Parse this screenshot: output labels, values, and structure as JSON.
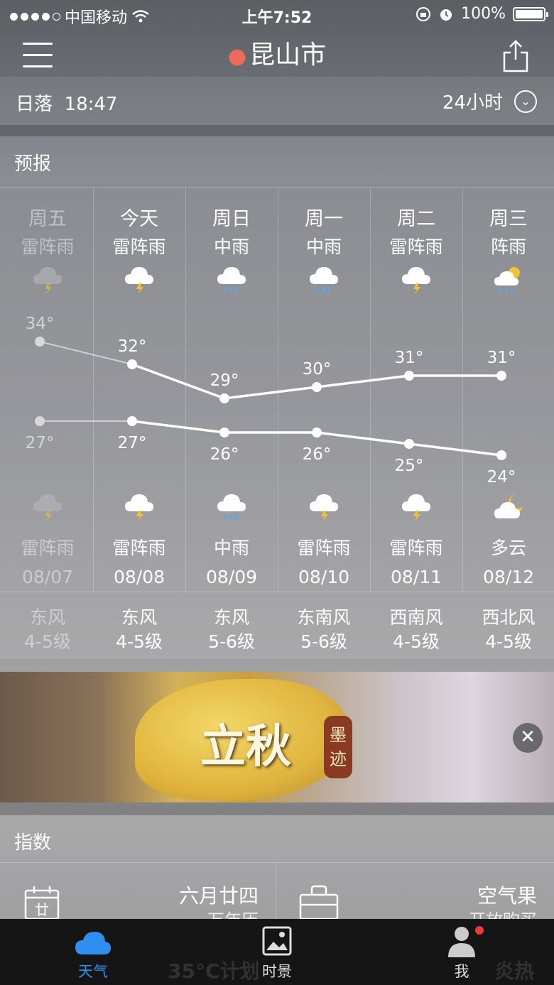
{
  "status_bar": {
    "carrier": "中国移动",
    "time": "上午7:52",
    "battery": "100%"
  },
  "header": {
    "city": "昆山市"
  },
  "sunset": {
    "label": "日落",
    "time": "18:47",
    "hours_toggle": "24小时"
  },
  "forecast": {
    "title": "预报",
    "days": [
      {
        "day": "周五",
        "cond_day": "雷阵雨",
        "high": "34°",
        "low": "27°",
        "cond_night": "雷阵雨",
        "date": "08/07",
        "wind": "东风",
        "level": "4-5级",
        "past": true,
        "icon_day": "thunder-cloud-icon",
        "icon_night": "thunder-cloud-icon"
      },
      {
        "day": "今天",
        "cond_day": "雷阵雨",
        "high": "32°",
        "low": "27°",
        "cond_night": "雷阵雨",
        "date": "08/08",
        "wind": "东风",
        "level": "4-5级",
        "past": false,
        "icon_day": "thunder-cloud-icon",
        "icon_night": "thunder-cloud-icon"
      },
      {
        "day": "周日",
        "cond_day": "中雨",
        "high": "29°",
        "low": "26°",
        "cond_night": "中雨",
        "date": "08/09",
        "wind": "东风",
        "level": "5-6级",
        "past": false,
        "icon_day": "rain-cloud-icon",
        "icon_night": "rain-cloud-icon"
      },
      {
        "day": "周一",
        "cond_day": "中雨",
        "high": "30°",
        "low": "26°",
        "cond_night": "雷阵雨",
        "date": "08/10",
        "wind": "东南风",
        "level": "5-6级",
        "past": false,
        "icon_day": "rain-cloud-icon",
        "icon_night": "thunder-cloud-icon"
      },
      {
        "day": "周二",
        "cond_day": "雷阵雨",
        "high": "31°",
        "low": "25°",
        "cond_night": "雷阵雨",
        "date": "08/11",
        "wind": "西南风",
        "level": "4-5级",
        "past": false,
        "icon_day": "thunder-cloud-icon",
        "icon_night": "thunder-cloud-icon"
      },
      {
        "day": "周三",
        "cond_day": "阵雨",
        "high": "31°",
        "low": "24°",
        "cond_night": "多云",
        "date": "08/12",
        "wind": "西北风",
        "level": "4-5级",
        "past": false,
        "icon_day": "sun-rain-icon",
        "icon_night": "moon-cloud-icon"
      }
    ]
  },
  "banner": {
    "text": "立秋",
    "seal": "墨迹"
  },
  "index": {
    "title": "指数",
    "items": [
      {
        "title": "六月廿四",
        "subtitle": "万年历",
        "icon": "calendar-icon"
      },
      {
        "title": "空气果",
        "subtitle": "开放购买",
        "icon": "shopping-bag-icon"
      }
    ]
  },
  "tabbar": {
    "items": [
      {
        "label": "天气",
        "icon": "cloud-icon",
        "active": true
      },
      {
        "label": "时景",
        "icon": "photo-icon",
        "active": false
      },
      {
        "label": "我",
        "icon": "person-icon",
        "active": false
      }
    ],
    "ghost_texts": [
      "35°C计划",
      "炎热"
    ]
  },
  "colors": {
    "accent": "#2f8ff0",
    "pin": "#f06a5a",
    "badge": "#f03a3a",
    "tabbar_bg": "#151515"
  }
}
